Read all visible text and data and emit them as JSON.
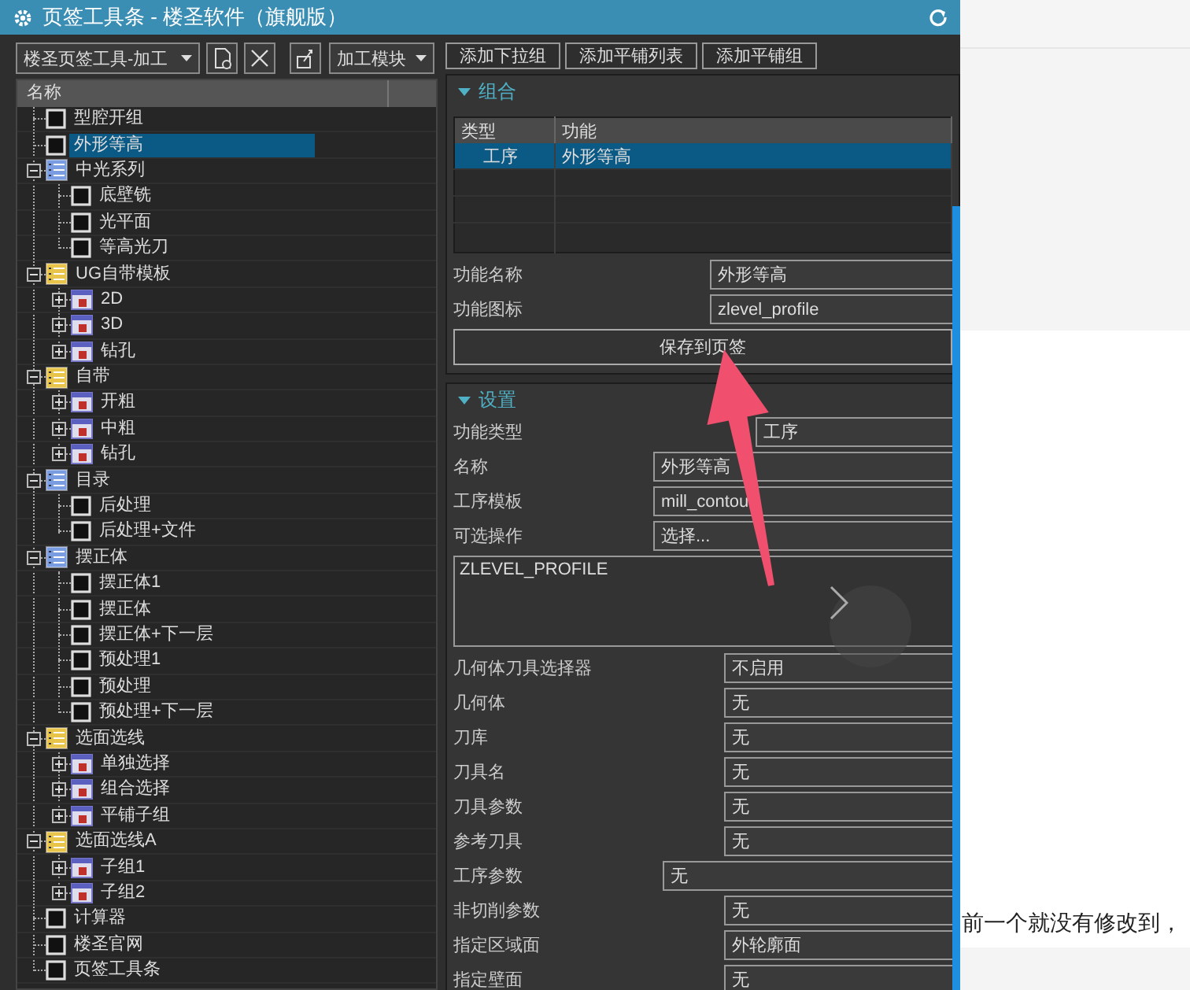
{
  "window": {
    "title": "页签工具条 - 楼圣软件（旗舰版）"
  },
  "toolbar": {
    "toolset": "楼圣页签工具-加工",
    "module": "加工模块"
  },
  "tree": {
    "columns": [
      "名称"
    ],
    "items": [
      {
        "label": "型腔开组",
        "kind": "command",
        "selected": false
      },
      {
        "label": "外形等高",
        "kind": "command",
        "selected": true
      },
      {
        "label": "中光系列",
        "kind": "group",
        "color": "#7a9ce0",
        "selected": false,
        "expanded": true,
        "children": [
          {
            "label": "底壁铣",
            "kind": "command",
            "selected": false
          },
          {
            "label": "光平面",
            "kind": "command",
            "selected": false
          },
          {
            "label": "等高光刀",
            "kind": "command",
            "selected": false
          }
        ]
      },
      {
        "label": "UG自带模板",
        "kind": "group",
        "color": "#e8c54a",
        "selected": false,
        "expanded": true,
        "children": [
          {
            "label": "2D",
            "kind": "subgroup",
            "selected": false,
            "expanded": false
          },
          {
            "label": "3D",
            "kind": "subgroup",
            "selected": false,
            "expanded": false
          },
          {
            "label": "钻孔",
            "kind": "subgroup",
            "selected": false,
            "expanded": false
          }
        ]
      },
      {
        "label": "自带",
        "kind": "group",
        "color": "#e8c54a",
        "selected": false,
        "expanded": true,
        "children": [
          {
            "label": "开粗",
            "kind": "subgroup",
            "selected": false,
            "expanded": false
          },
          {
            "label": "中粗",
            "kind": "subgroup",
            "selected": false,
            "expanded": false
          },
          {
            "label": "钻孔",
            "kind": "subgroup",
            "selected": false,
            "expanded": false
          }
        ]
      },
      {
        "label": "目录",
        "kind": "group",
        "color": "#7a9ce0",
        "selected": false,
        "expanded": true,
        "children": [
          {
            "label": "后处理",
            "kind": "command",
            "selected": false
          },
          {
            "label": "后处理+文件",
            "kind": "command",
            "selected": false
          }
        ]
      },
      {
        "label": "摆正体",
        "kind": "group",
        "color": "#7a9ce0",
        "selected": false,
        "expanded": true,
        "children": [
          {
            "label": "摆正体1",
            "kind": "command",
            "selected": false
          },
          {
            "label": "摆正体",
            "kind": "command",
            "selected": false
          },
          {
            "label": "摆正体+下一层",
            "kind": "command",
            "selected": false
          },
          {
            "label": "预处理1",
            "kind": "command",
            "selected": false
          },
          {
            "label": "预处理",
            "kind": "command",
            "selected": false
          },
          {
            "label": "预处理+下一层",
            "kind": "command",
            "selected": false
          }
        ]
      },
      {
        "label": "选面选线",
        "kind": "group",
        "color": "#e8c54a",
        "selected": false,
        "expanded": true,
        "children": [
          {
            "label": "单独选择",
            "kind": "subgroup",
            "selected": false,
            "expanded": false
          },
          {
            "label": "组合选择",
            "kind": "subgroup",
            "selected": false,
            "expanded": false
          },
          {
            "label": "平铺子组",
            "kind": "subgroup",
            "selected": false,
            "expanded": false
          }
        ]
      },
      {
        "label": "选面选线A",
        "kind": "group",
        "color": "#e8c54a",
        "selected": false,
        "expanded": true,
        "children": [
          {
            "label": "子组1",
            "kind": "subgroup",
            "selected": false,
            "expanded": false
          },
          {
            "label": "子组2",
            "kind": "subgroup",
            "selected": false,
            "expanded": false
          }
        ]
      },
      {
        "label": "计算器",
        "kind": "command",
        "selected": false
      },
      {
        "label": "楼圣官网",
        "kind": "command",
        "selected": false
      },
      {
        "label": "页签工具条",
        "kind": "command",
        "selected": false
      }
    ]
  },
  "actions": [
    "添加下拉组",
    "添加平铺列表",
    "添加平铺组"
  ],
  "combo_section": {
    "title": "组合",
    "expanded": true,
    "table": {
      "columns": [
        "类型",
        "功能"
      ],
      "rows": [
        {
          "type": "工序",
          "function": "外形等高",
          "selected": true
        }
      ]
    },
    "fields": [
      {
        "label": "功能名称",
        "value": "外形等高"
      },
      {
        "label": "功能图标",
        "value": "zlevel_profile"
      }
    ],
    "save_button": "保存到页签"
  },
  "settings_section": {
    "title": "设置",
    "expanded": true,
    "fields": [
      {
        "label": "功能类型",
        "kind": "type-dropdown",
        "value": "工序"
      },
      {
        "label": "名称",
        "kind": "input",
        "value": "外形等高"
      },
      {
        "label": "工序模板",
        "kind": "input",
        "value": "mill_contou"
      },
      {
        "label": "可选操作",
        "kind": "button",
        "value": "选择..."
      },
      {
        "kind": "textarea",
        "value": "ZLEVEL_PROFILE"
      },
      {
        "label": "几何体刀具选择器",
        "kind": "dropdown",
        "value": "不启用"
      },
      {
        "label": "几何体",
        "kind": "dropdown",
        "value": "无"
      },
      {
        "label": "刀库",
        "kind": "dropdown",
        "value": "无"
      },
      {
        "label": "刀具名",
        "kind": "dropdown",
        "value": "无"
      },
      {
        "label": "刀具参数",
        "kind": "dropdown",
        "value": "无"
      },
      {
        "label": "参考刀具",
        "kind": "dropdown",
        "value": "无"
      },
      {
        "label": "工序参数",
        "kind": "param",
        "value": "无"
      },
      {
        "label": "非切削参数",
        "kind": "dropdown",
        "value": "无"
      },
      {
        "label": "指定区域面",
        "kind": "dropdown",
        "value": "外轮廓面"
      },
      {
        "label": "指定壁面",
        "kind": "dropdown",
        "value": "无"
      }
    ]
  },
  "background_page": {
    "text": "前一个就没有修改到，"
  }
}
